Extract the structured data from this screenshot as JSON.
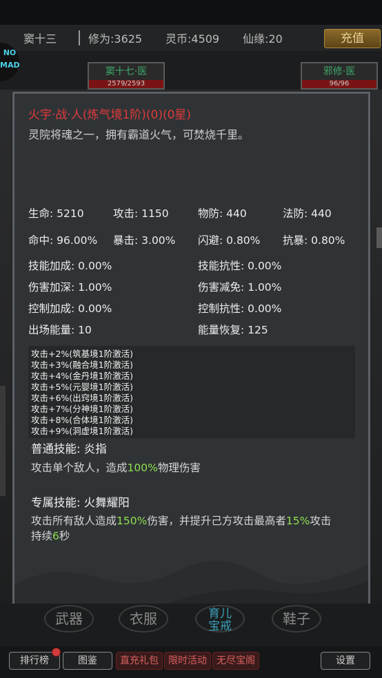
{
  "header": {
    "player_name": "窦十三",
    "cultivation": "修为:3625",
    "spirit_coins": "灵币:4509",
    "fate": "仙缘:20",
    "recharge_label": "充值"
  },
  "left_badge": "NO\nMAD",
  "units": [
    {
      "name": "窦十七·医",
      "hp": "2579/2593"
    },
    {
      "name": "邪修·医",
      "hp": "96/96"
    }
  ],
  "hero": {
    "title": "火宇·战·人(炼气境1阶)(0)(0星)",
    "description": "灵院将魂之一，拥有霸道火气，可焚烧千里。",
    "stats_row1": [
      "生命: 5210",
      "攻击: 1150",
      "物防: 440",
      "法防: 440"
    ],
    "stats_row2": [
      "命中: 96.00%",
      "暴击: 3.00%",
      "闪避: 0.80%",
      "抗暴: 0.80%"
    ],
    "stats_pairs": [
      [
        "技能加成: 0.00%",
        "技能抗性: 0.00%"
      ],
      [
        "伤害加深: 1.00%",
        "伤害减免: 1.00%"
      ],
      [
        "控制加成: 0.00%",
        "控制抗性: 0.00%"
      ],
      [
        "出场能量: 10",
        "能量恢复: 125"
      ]
    ],
    "activations": [
      "攻击+2%(筑基境1阶激活)",
      "攻击+3%(融合境1阶激活)",
      "攻击+4%(金丹境1阶激活)",
      "攻击+5%(元婴境1阶激活)",
      "攻击+6%(出窍境1阶激活)",
      "攻击+7%(分神境1阶激活)",
      "攻击+8%(合体境1阶激活)",
      "攻击+9%(洞虚境1阶激活)"
    ],
    "normal_skill": {
      "title": "普通技能: 炎指",
      "desc_pre": "攻击单个敌人，造成",
      "desc_hl": "100%",
      "desc_post": "物理伤害"
    },
    "special_skill": {
      "title": "专属技能: 火舞耀阳",
      "desc_a": "攻击所有敌人造成",
      "hl1": "150%",
      "desc_b": "伤害，并提升己方攻击最高者",
      "hl2": "15%",
      "desc_c": "攻击",
      "desc_d": "持续",
      "hl3": "6",
      "desc_e": "秒"
    }
  },
  "equipment": [
    "武器",
    "衣服",
    "育儿宝戒",
    "鞋子"
  ],
  "bottom_nav": {
    "rank": "排行榜",
    "atlas": "图鉴",
    "gift": "直充礼包",
    "event": "限时活动",
    "treasure": "无尽宝阁",
    "settings": "设置"
  }
}
